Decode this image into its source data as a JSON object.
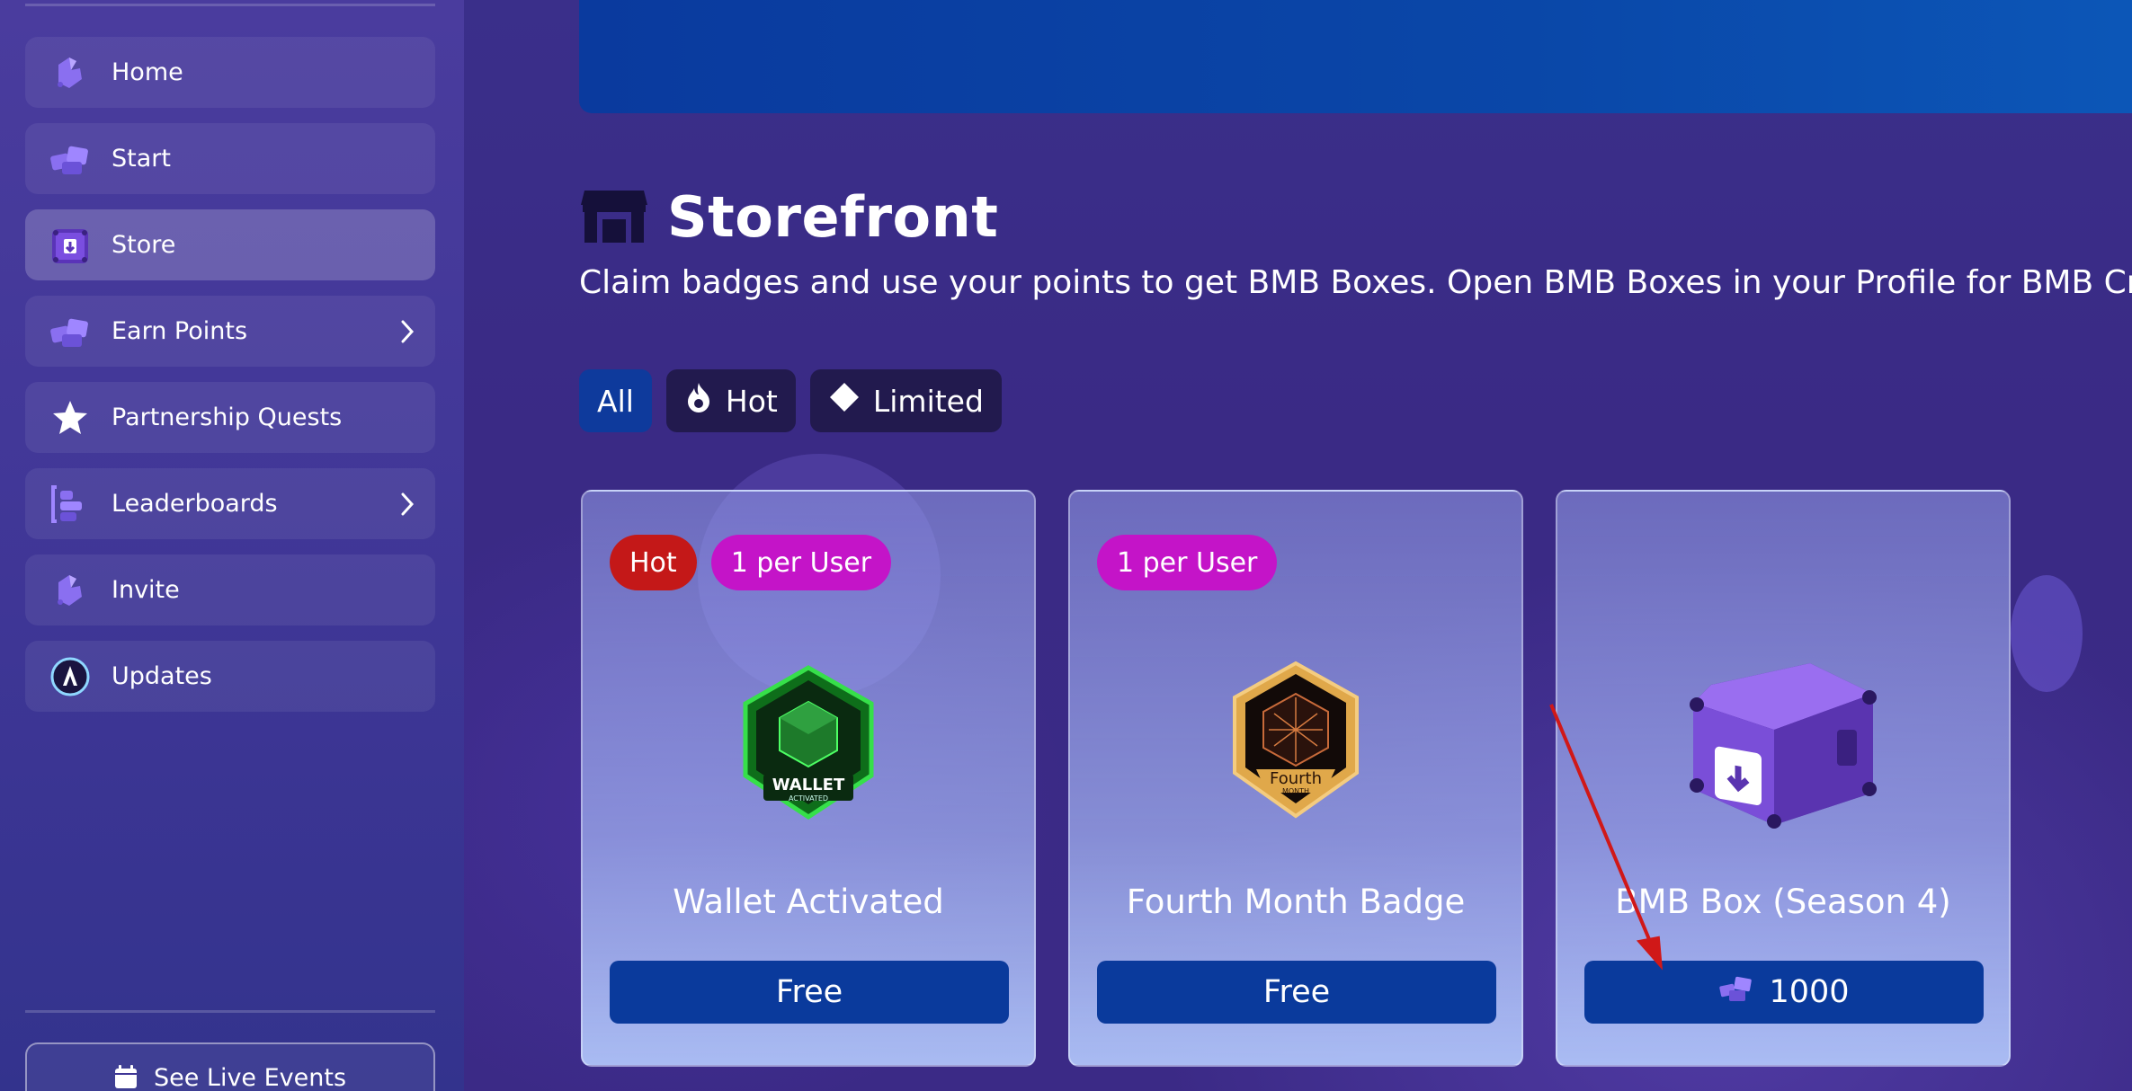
{
  "sidebar": {
    "items": [
      {
        "label": "Home",
        "icon": "home-icon"
      },
      {
        "label": "Start",
        "icon": "start-icon"
      },
      {
        "label": "Store",
        "icon": "store-chest-icon",
        "active": true
      },
      {
        "label": "Earn Points",
        "icon": "earn-points-icon",
        "has_submenu": true
      },
      {
        "label": "Partnership Quests",
        "icon": "star-icon"
      },
      {
        "label": "Leaderboards",
        "icon": "leaderboards-icon",
        "has_submenu": true
      },
      {
        "label": "Invite",
        "icon": "invite-icon"
      },
      {
        "label": "Updates",
        "icon": "updates-logo-icon"
      }
    ],
    "live_events_label": "See Live Events"
  },
  "main": {
    "title": "Storefront",
    "subtitle": "Claim badges and use your points to get BMB Boxes. Open BMB Boxes in your Profile for BMB Creds",
    "filters": [
      {
        "label": "All",
        "active": true
      },
      {
        "label": "Hot",
        "icon": "flame-icon"
      },
      {
        "label": "Limited",
        "icon": "diamond-icon"
      }
    ],
    "cards": [
      {
        "name": "Wallet Activated",
        "badges": [
          "Hot",
          "1 per User"
        ],
        "price": "Free",
        "art_text": "WALLET",
        "art_subtext": "ACTIVATED"
      },
      {
        "name": "Fourth Month Badge",
        "badges": [
          "1 per User"
        ],
        "price": "Free",
        "art_text": "Fourth",
        "art_subtext": "MONTH"
      },
      {
        "name": "BMB Box (Season 4)",
        "badges": [],
        "price": "1000",
        "price_icon": "points-icon"
      }
    ]
  },
  "colors": {
    "accent": "#0a3a9c",
    "hot": "#c41818",
    "limited": "#c414c8",
    "annotation_arrow": "#d01818"
  }
}
